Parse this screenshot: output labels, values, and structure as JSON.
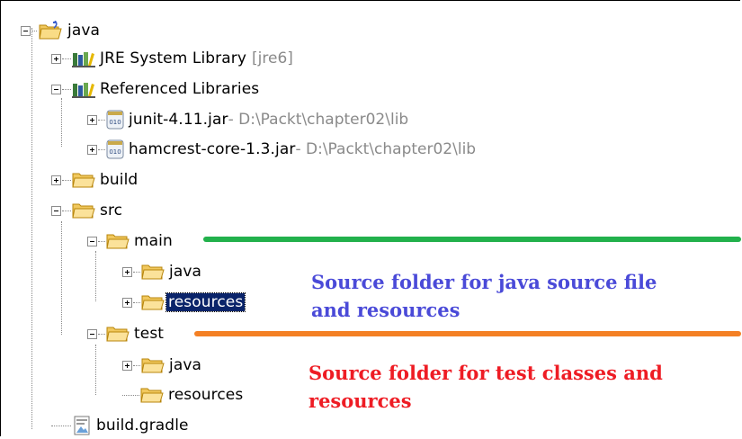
{
  "tree": {
    "root": {
      "label": "java"
    },
    "jre": {
      "label": "JRE System Library",
      "suffix": "[jre6]"
    },
    "ref_libs": {
      "label": "Referenced Libraries"
    },
    "junit": {
      "label": "junit-4.11.jar",
      "path": " - D:\\Packt\\chapter02\\lib"
    },
    "hamcrest": {
      "label": "hamcrest-core-1.3.jar",
      "path": " - D:\\Packt\\chapter02\\lib"
    },
    "build": {
      "label": "build"
    },
    "src": {
      "label": "src"
    },
    "main": {
      "label": "main"
    },
    "main_java": {
      "label": "java"
    },
    "main_resources": {
      "label": "resources"
    },
    "test": {
      "label": "test"
    },
    "test_java": {
      "label": "java"
    },
    "test_resources": {
      "label": "resources"
    },
    "build_gradle": {
      "label": "build.gradle"
    }
  },
  "annotations": {
    "main_note": {
      "line1": "Source folder for java source file",
      "line2": "and resources",
      "color": "#4a4ad8"
    },
    "test_note": {
      "line1": "Source folder for test classes and",
      "line2": "resources",
      "color": "#ee1c24"
    }
  },
  "colors": {
    "main_bar": "#22b14c",
    "test_bar": "#f48024",
    "selection": "#0a246a"
  }
}
